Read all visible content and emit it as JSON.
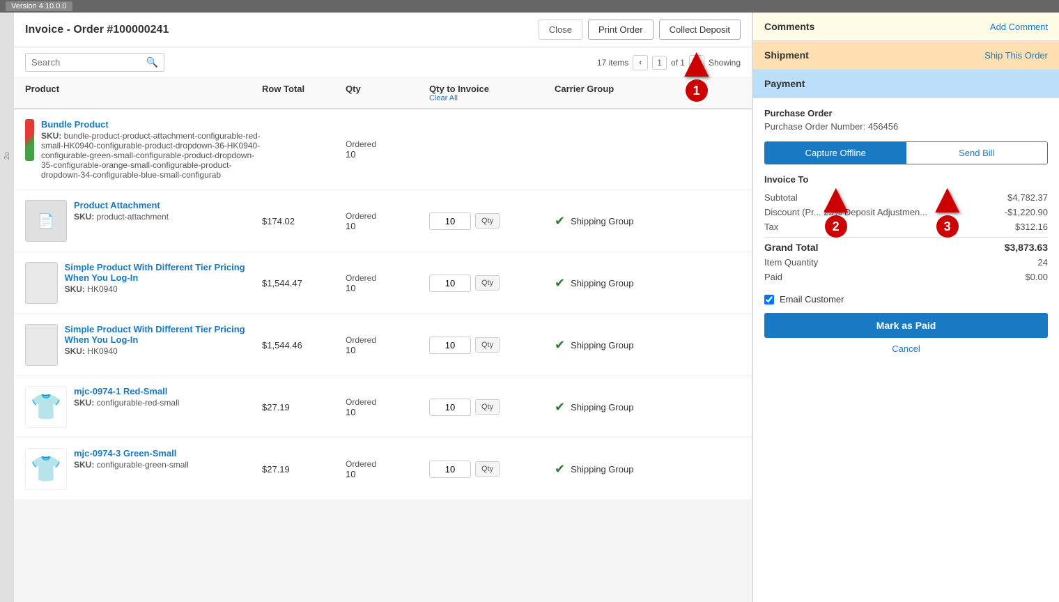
{
  "version_bar": {
    "label": "Version 4.10.0.0"
  },
  "header": {
    "title": "Invoice - Order #100000241",
    "close_btn": "Close",
    "print_btn": "Print Order",
    "collect_btn": "Collect Deposit"
  },
  "toolbar": {
    "search_placeholder": "Search",
    "items_count": "17 items",
    "page_current": "1",
    "page_of": "of 1",
    "showing_text": "Showing"
  },
  "table": {
    "col_product": "Product",
    "col_row_total": "Row Total",
    "col_qty": "Qty",
    "col_qty_invoice": "Qty to Invoice",
    "col_carrier_group": "Carrier Group",
    "clear_all": "Clear All",
    "rows": [
      {
        "id": 1,
        "name": "Bundle Product",
        "sku": "bundle-product-product-attachment-configurable-red-small-HK0940-configurable-product-dropdown-36-HK0940-configurable-green-small-configurable-product-dropdown-35-configurable-orange-small-configurable-product-dropdown-34-configurable-blue-small-configurab",
        "row_total": "",
        "qty_label": "Ordered",
        "qty_value": "10",
        "qty_invoice": "",
        "carrier_group": "",
        "has_input": false,
        "img_type": "bundle"
      },
      {
        "id": 2,
        "name": "Product Attachment",
        "sku": "product-attachment",
        "row_total": "$174.02",
        "qty_label": "Ordered",
        "qty_value": "10",
        "qty_invoice": "10",
        "carrier_group": "Shipping Group",
        "has_input": true,
        "img_type": "attachment"
      },
      {
        "id": 3,
        "name": "Simple Product With Different Tier Pricing When You Log-In",
        "sku": "HK0940",
        "row_total": "$1,544.47",
        "qty_label": "Ordered",
        "qty_value": "10",
        "qty_invoice": "10",
        "carrier_group": "Shipping Group",
        "has_input": true,
        "img_type": "simple"
      },
      {
        "id": 4,
        "name": "Simple Product With Different Tier Pricing When You Log-In",
        "sku": "HK0940",
        "row_total": "$1,544.46",
        "qty_label": "Ordered",
        "qty_value": "10",
        "qty_invoice": "10",
        "carrier_group": "Shipping Group",
        "has_input": true,
        "img_type": "simple"
      },
      {
        "id": 5,
        "name": "mjc-0974-1 Red-Small",
        "sku": "configurable-red-small",
        "row_total": "$27.19",
        "qty_label": "Ordered",
        "qty_value": "10",
        "qty_invoice": "10",
        "carrier_group": "Shipping Group",
        "has_input": true,
        "img_type": "red-shirt"
      },
      {
        "id": 6,
        "name": "mjc-0974-3 Green-Small",
        "sku": "configurable-green-small",
        "row_total": "$27.19",
        "qty_label": "Ordered",
        "qty_value": "10",
        "qty_invoice": "10",
        "carrier_group": "Shipping Group",
        "has_input": true,
        "img_type": "green-shirt"
      }
    ]
  },
  "right_panel": {
    "comments": {
      "title": "Comments",
      "action": "Add Comment"
    },
    "shipment": {
      "title": "Shipment",
      "action": "Ship This Order"
    },
    "payment": {
      "title": "Payment",
      "purchase_order_label": "Purchase Order",
      "purchase_order_num_label": "Purchase Order Number:",
      "purchase_order_num": "456456",
      "capture_offline_btn": "Capture Offline",
      "send_bill_btn": "Send Bill",
      "invoice_to_title": "Invoice To",
      "subtotal_label": "Subtotal",
      "subtotal_value": "$4,782.37",
      "discount_label": "Discount (Pr... 25% Deposit Adjustmen...",
      "discount_value": "-$1,220.90",
      "tax_label": "Tax",
      "tax_value": "$312.16",
      "grand_total_label": "Grand Total",
      "grand_total_value": "$3,873.63",
      "item_qty_label": "Item Quantity",
      "item_qty_value": "24",
      "paid_label": "Paid",
      "paid_value": "$0.00",
      "email_customer_label": "Email Customer",
      "mark_paid_btn": "Mark as Paid",
      "cancel_link": "Cancel"
    }
  },
  "annotations": {
    "arrow1": "1",
    "arrow2": "2",
    "arrow3": "3"
  }
}
